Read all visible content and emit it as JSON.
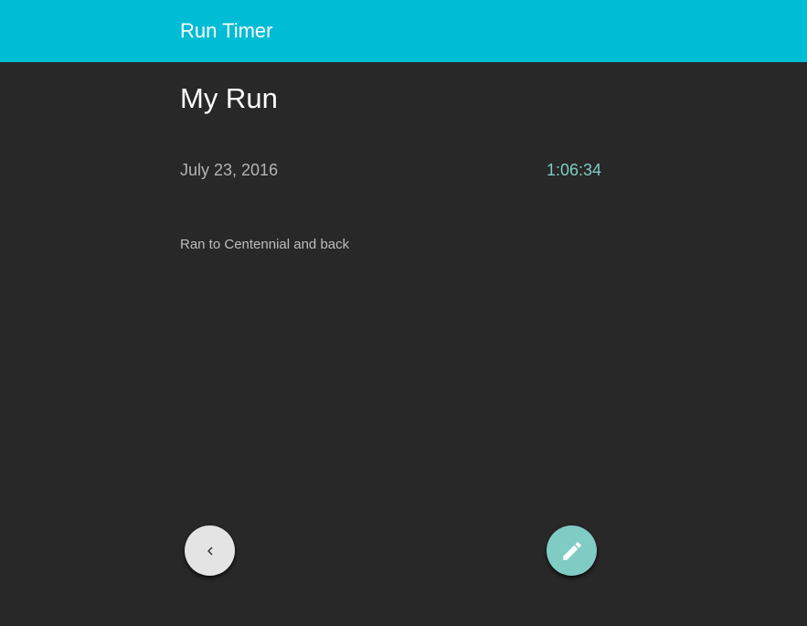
{
  "app_bar": {
    "title": "Run Timer",
    "color": "#00bcd4"
  },
  "run": {
    "title": "My Run",
    "date": "July 23, 2016",
    "duration": "1:06:34",
    "notes": "Ran to Centennial and back"
  },
  "actions": {
    "back_icon": "chevron-left-icon",
    "edit_icon": "pencil-icon",
    "accent_color": "#80cbc4"
  }
}
